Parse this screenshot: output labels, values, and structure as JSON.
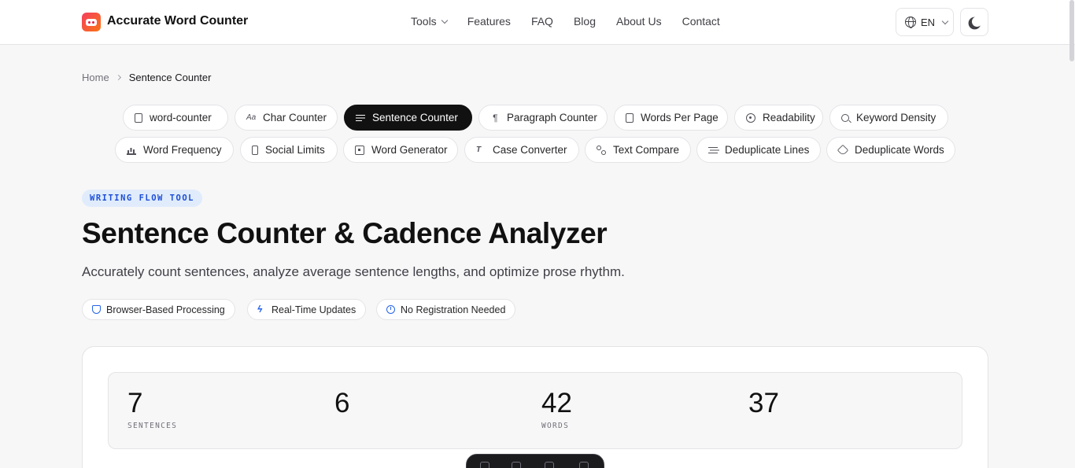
{
  "header": {
    "brand": "Accurate Word Counter",
    "nav": [
      "Tools",
      "Features",
      "FAQ",
      "Blog",
      "About Us",
      "Contact"
    ],
    "lang": "EN"
  },
  "breadcrumb": {
    "home": "Home",
    "current": "Sentence Counter"
  },
  "tools_row1": [
    "word-counter",
    "Char Counter",
    "Sentence Counter",
    "Paragraph Counter",
    "Words Per Page",
    "Readability",
    "Keyword Density"
  ],
  "tools_row2": [
    "Word Frequency",
    "Social Limits",
    "Word Generator",
    "Case Converter",
    "Text Compare",
    "Deduplicate Lines",
    "Deduplicate Words"
  ],
  "hero": {
    "badge": "WRITING FLOW TOOL",
    "title": "Sentence Counter & Cadence Analyzer",
    "subtitle": "Accurately count sentences, analyze average sentence lengths, and optimize prose rhythm.",
    "features": [
      "Browser-Based Processing",
      "Real-Time Updates",
      "No Registration Needed"
    ]
  },
  "stats": [
    {
      "value": "7",
      "label": "SENTENCES"
    },
    {
      "value": "6",
      "label": ""
    },
    {
      "value": "42",
      "label": "WORDS"
    },
    {
      "value": "37",
      "label": ""
    }
  ],
  "colors": {
    "accent": "#2563eb",
    "active_pill": "#111111",
    "badge_bg": "#e0ecfb"
  }
}
